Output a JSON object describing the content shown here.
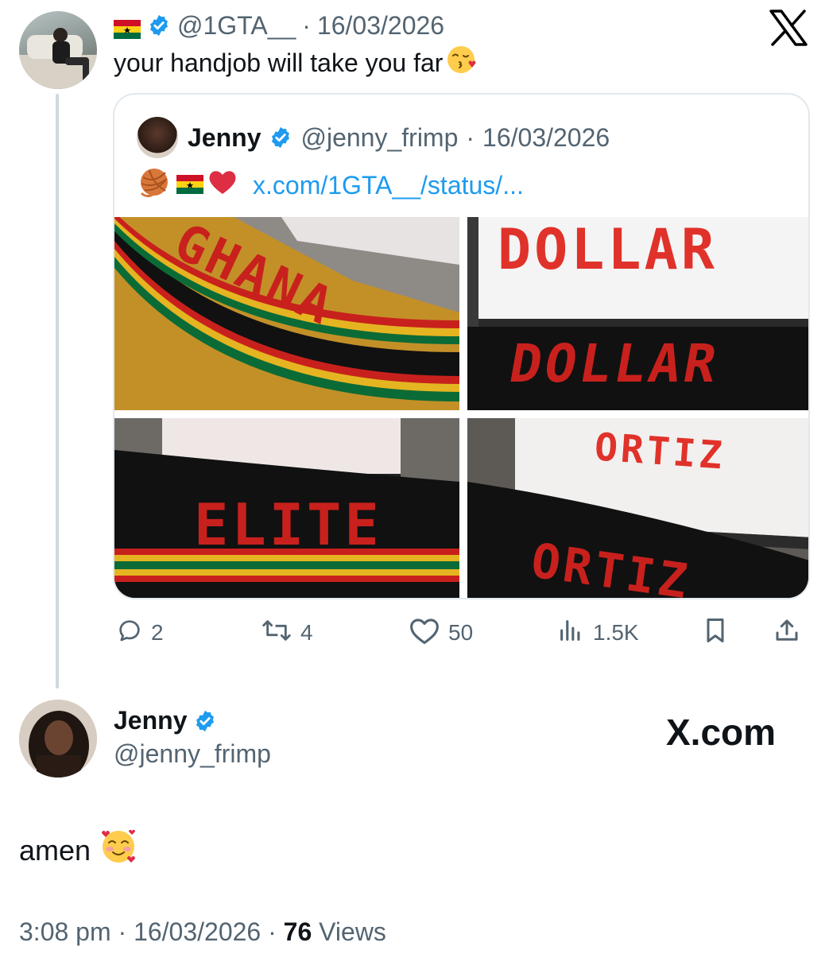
{
  "top_tweet": {
    "handle": "@1GTA__",
    "date": "16/03/2026",
    "separator": "·",
    "text": "your handjob will take you far",
    "close_label": "X"
  },
  "quoted_tweet": {
    "name": "Jenny",
    "handle": "@jenny_frimp",
    "date": "16/03/2026",
    "separator": "·",
    "link": "x.com/1GTA__/status/...",
    "photos": [
      {
        "text": "GHANA"
      },
      {
        "screen_text": "DOLLAR",
        "text": "DOLLAR"
      },
      {
        "text": "ELITE"
      },
      {
        "screen_text": "ORTIZ",
        "text": "ORTIZ"
      }
    ]
  },
  "actions": {
    "replies": "2",
    "reposts": "4",
    "likes": "50",
    "views": "1.5K"
  },
  "main_tweet": {
    "name": "Jenny",
    "handle": "@jenny_frimp",
    "brand": "X.com",
    "text": "amen",
    "time": "3:08 pm",
    "date": "16/03/2026",
    "views_count": "76",
    "views_label": "Views",
    "separator": "·"
  },
  "colors": {
    "accent": "#1d9bf0",
    "text": "#0f1419",
    "muted": "#536471",
    "ghana_red": "#ce1126",
    "ghana_gold": "#fcd116",
    "ghana_green": "#006b3f"
  },
  "icons": [
    "reply-icon",
    "repost-icon",
    "like-icon",
    "views-icon",
    "bookmark-icon",
    "share-icon",
    "verified-icon",
    "ghana-flag-icon",
    "yarn-icon",
    "heart-icon",
    "kiss-emoji-icon",
    "smiling-hearts-emoji-icon"
  ]
}
